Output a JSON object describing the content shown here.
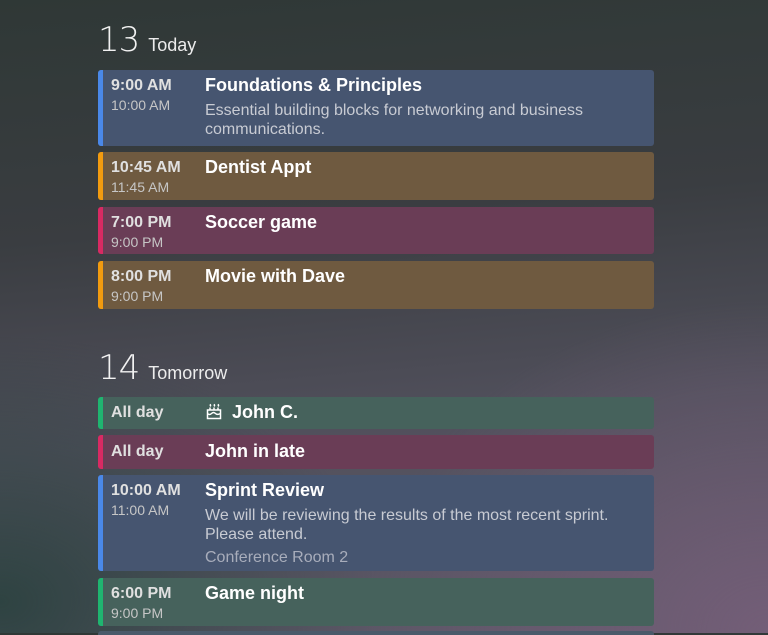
{
  "colors": {
    "blue": "#4a88e8",
    "orange": "#f29b0f",
    "pink": "#d82a63",
    "green": "#1fb570",
    "blue_bg": "#465570",
    "orange_bg": "#6f5a40",
    "pink_bg": "#6a3d56",
    "green_bg": "#46625c"
  },
  "days": [
    {
      "number": "13",
      "label": "Today",
      "events": [
        {
          "start": "9:00 AM",
          "end": "10:00 AM",
          "title": "Foundations & Principles",
          "description": "Essential building blocks for networking and business communications.",
          "color": "blue"
        },
        {
          "start": "10:45 AM",
          "end": "11:45 AM",
          "title": "Dentist Appt",
          "color": "orange"
        },
        {
          "start": "7:00 PM",
          "end": "9:00 PM",
          "title": "Soccer game",
          "color": "pink"
        },
        {
          "start": "8:00 PM",
          "end": "9:00 PM",
          "title": "Movie with Dave",
          "color": "orange"
        }
      ]
    },
    {
      "number": "14",
      "label": "Tomorrow",
      "events": [
        {
          "start": "All day",
          "title": "John C.",
          "icon": "birthday-cake-icon",
          "color": "green"
        },
        {
          "start": "All day",
          "title": "John in late",
          "color": "pink"
        },
        {
          "start": "10:00 AM",
          "end": "11:00 AM",
          "title": "Sprint Review",
          "description": "We will be reviewing the results of the most recent sprint. Please attend.",
          "location": "Conference Room 2",
          "color": "blue"
        },
        {
          "start": "6:00 PM",
          "end": "9:00 PM",
          "title": "Game night",
          "color": "green"
        }
      ]
    }
  ]
}
